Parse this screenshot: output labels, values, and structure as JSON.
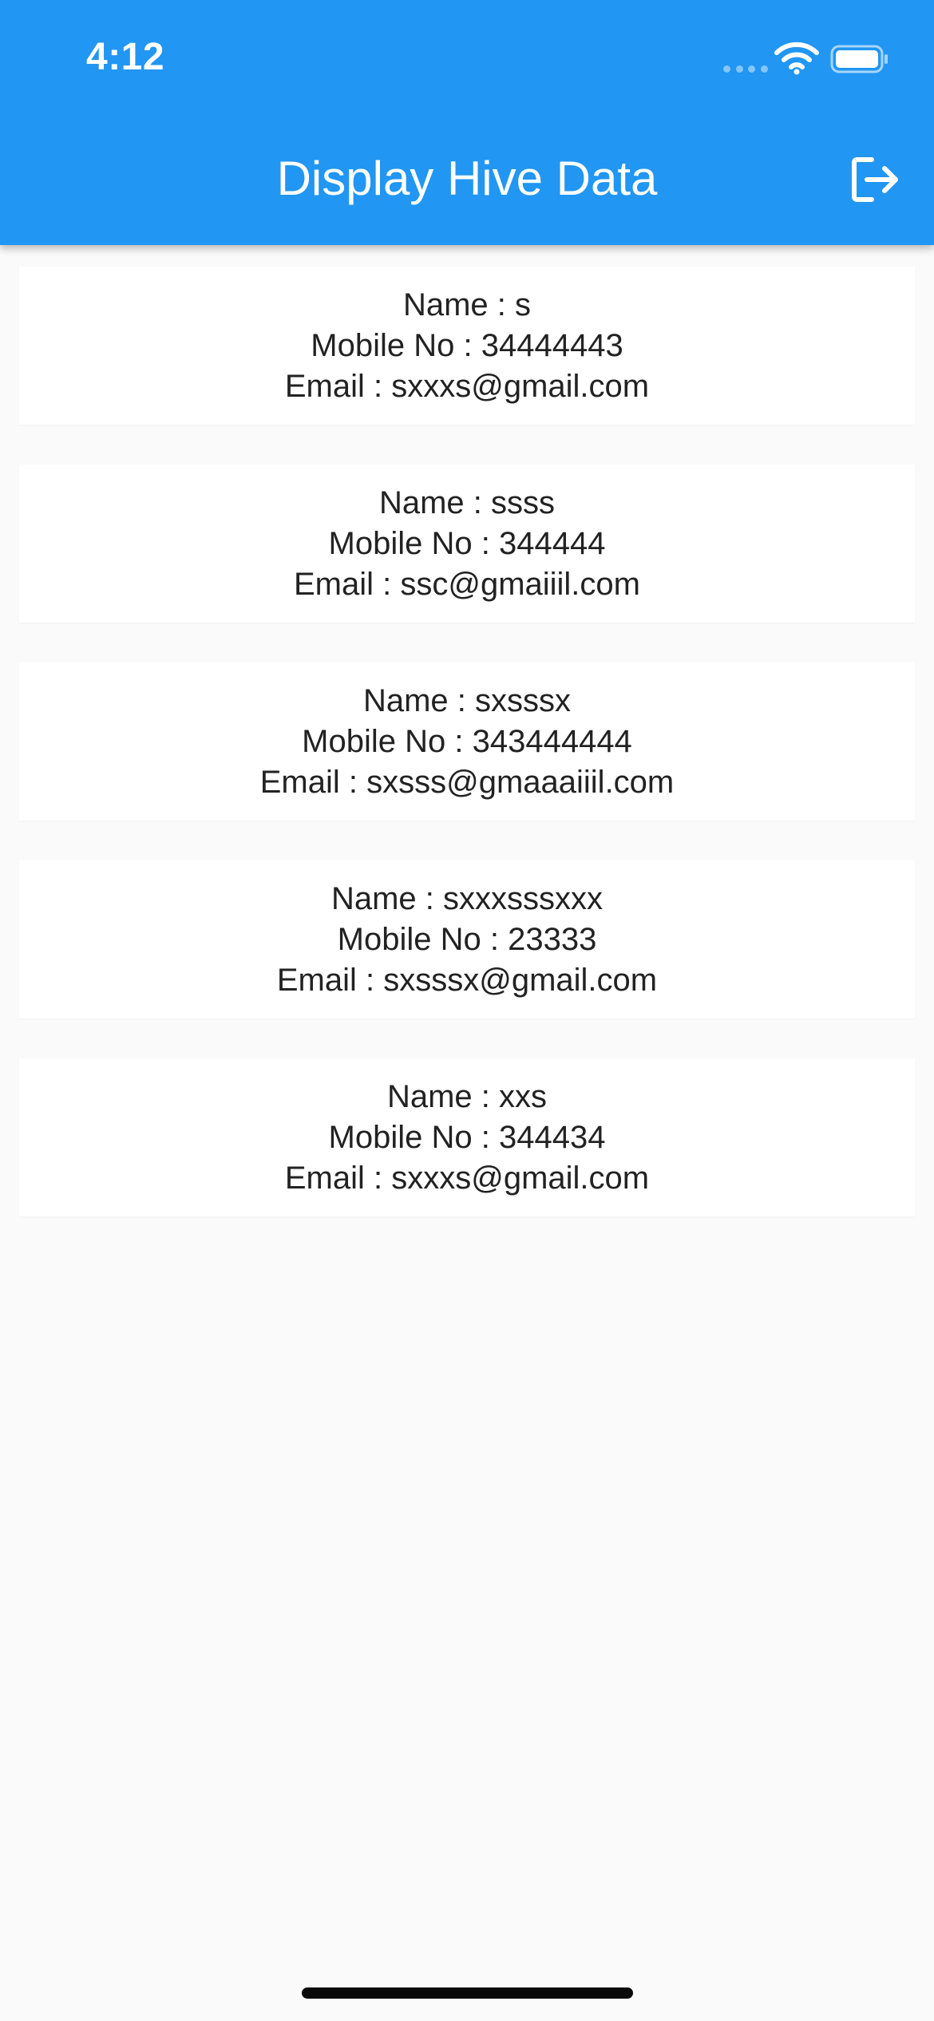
{
  "status_bar": {
    "time": "4:12",
    "icons": [
      "cellular-signal-icon",
      "wifi-icon",
      "battery-icon"
    ]
  },
  "app_bar": {
    "title": "Display Hive Data",
    "action_icon": "logout-icon",
    "color": "#2196f3"
  },
  "records": [
    {
      "name": "Name : s",
      "mobile": "Mobile No : 34444443",
      "email": "Email : sxxxs@gmail.com"
    },
    {
      "name": "Name : ssss",
      "mobile": "Mobile No : 344444",
      "email": "Email : ssc@gmaiiil.com"
    },
    {
      "name": "Name : sxsssx",
      "mobile": "Mobile No : 343444444",
      "email": "Email : sxsss@gmaaaiiil.com"
    },
    {
      "name": "Name : sxxxsssxxx",
      "mobile": "Mobile No : 23333",
      "email": "Email : sxsssx@gmail.com"
    },
    {
      "name": "Name : xxs",
      "mobile": "Mobile No : 344434",
      "email": "Email : sxxxs@gmail.com"
    }
  ]
}
